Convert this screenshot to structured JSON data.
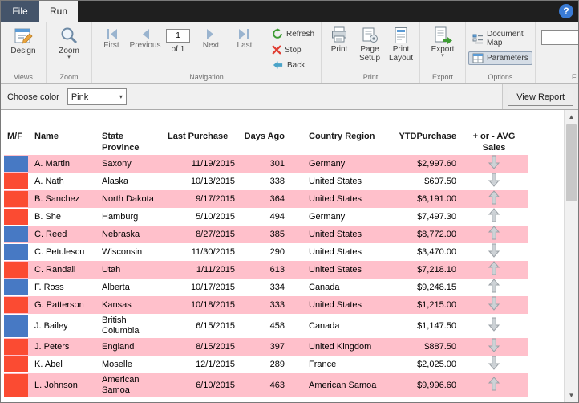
{
  "window": {
    "help_glyph": "?"
  },
  "tabs": {
    "file": "File",
    "run": "Run"
  },
  "ribbon": {
    "views": {
      "design": "Design",
      "label": "Views"
    },
    "zoom": {
      "zoom": "Zoom",
      "label": "Zoom"
    },
    "navigation": {
      "first": "First",
      "previous": "Previous",
      "page_value": "1",
      "of": "of 1",
      "next": "Next",
      "last": "Last",
      "refresh": "Refresh",
      "stop": "Stop",
      "back": "Back",
      "label": "Navigation"
    },
    "print": {
      "print": "Print",
      "page_setup": "Page Setup",
      "print_layout": "Print Layout",
      "label": "Print"
    },
    "export": {
      "export": "Export",
      "label": "Export"
    },
    "options": {
      "document_map": "Document Map",
      "parameters": "Parameters",
      "label": "Options"
    },
    "find": {
      "label": "Find"
    }
  },
  "parameters_bar": {
    "choose_color_label": "Choose color",
    "color_value": "Pink",
    "view_report": "View Report"
  },
  "report": {
    "columns": [
      "M/F",
      "Name",
      "State Province",
      "Last Purchase",
      "Days Ago",
      "Country Region",
      "YTDPurchase",
      "+ or - AVG Sales"
    ],
    "colors": {
      "blue": "#4779c4",
      "red": "#fb4b32",
      "alt_row": "#ffc0cb"
    },
    "rows": [
      {
        "name": "A. Martin",
        "state": "Saxony",
        "last_purchase": "11/19/2015",
        "days_ago": "301",
        "country": "Germany",
        "ytd": "$2,997.60",
        "bar": "blue",
        "trend": "down"
      },
      {
        "name": "A. Nath",
        "state": "Alaska",
        "last_purchase": "10/13/2015",
        "days_ago": "338",
        "country": "United States",
        "ytd": "$607.50",
        "bar": "red",
        "trend": "down"
      },
      {
        "name": "B. Sanchez",
        "state": "North Dakota",
        "last_purchase": "9/17/2015",
        "days_ago": "364",
        "country": "United States",
        "ytd": "$6,191.00",
        "bar": "red",
        "trend": "up"
      },
      {
        "name": "B. She",
        "state": "Hamburg",
        "last_purchase": "5/10/2015",
        "days_ago": "494",
        "country": "Germany",
        "ytd": "$7,497.30",
        "bar": "red",
        "trend": "up"
      },
      {
        "name": "C. Reed",
        "state": "Nebraska",
        "last_purchase": "8/27/2015",
        "days_ago": "385",
        "country": "United States",
        "ytd": "$8,772.00",
        "bar": "blue",
        "trend": "up"
      },
      {
        "name": "C. Petulescu",
        "state": "Wisconsin",
        "last_purchase": "11/30/2015",
        "days_ago": "290",
        "country": "United States",
        "ytd": "$3,470.00",
        "bar": "blue",
        "trend": "down"
      },
      {
        "name": "C. Randall",
        "state": "Utah",
        "last_purchase": "1/11/2015",
        "days_ago": "613",
        "country": "United States",
        "ytd": "$7,218.10",
        "bar": "red",
        "trend": "up"
      },
      {
        "name": "F. Ross",
        "state": "Alberta",
        "last_purchase": "10/17/2015",
        "days_ago": "334",
        "country": "Canada",
        "ytd": "$9,248.15",
        "bar": "blue",
        "trend": "up"
      },
      {
        "name": "G. Patterson",
        "state": "Kansas",
        "last_purchase": "10/18/2015",
        "days_ago": "333",
        "country": "United States",
        "ytd": "$1,215.00",
        "bar": "red",
        "trend": "down"
      },
      {
        "name": "J. Bailey",
        "state": "British Columbia",
        "last_purchase": "6/15/2015",
        "days_ago": "458",
        "country": "Canada",
        "ytd": "$1,147.50",
        "bar": "blue",
        "trend": "down"
      },
      {
        "name": "J. Peters",
        "state": "England",
        "last_purchase": "8/15/2015",
        "days_ago": "397",
        "country": "United Kingdom",
        "ytd": "$887.50",
        "bar": "red",
        "trend": "down"
      },
      {
        "name": "K. Abel",
        "state": "Moselle",
        "last_purchase": "12/1/2015",
        "days_ago": "289",
        "country": "France",
        "ytd": "$2,025.00",
        "bar": "red",
        "trend": "down"
      },
      {
        "name": "L. Johnson",
        "state": "American Samoa",
        "last_purchase": "6/10/2015",
        "days_ago": "463",
        "country": "American Samoa",
        "ytd": "$9,996.60",
        "bar": "red",
        "trend": "up"
      }
    ]
  }
}
